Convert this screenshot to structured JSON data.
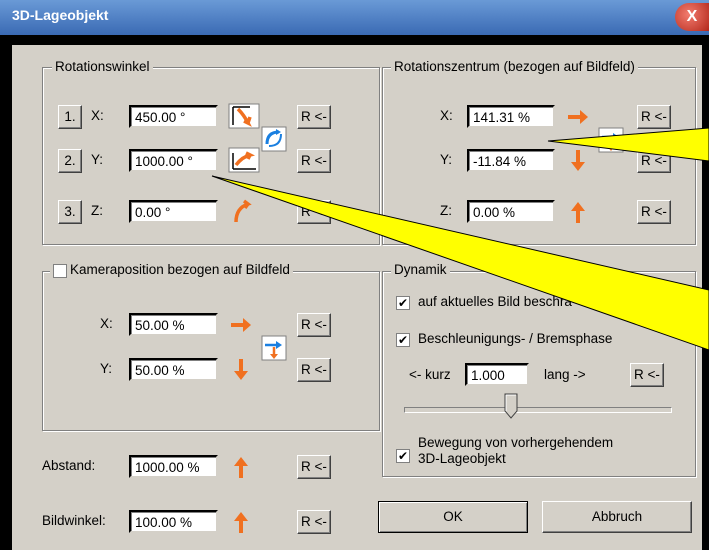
{
  "window": {
    "title": "3D-Lageobjekt",
    "close_glyph": "X"
  },
  "rotation": {
    "group_title": "Rotationswinkel",
    "rows": [
      {
        "num": "1.",
        "axis": "X:",
        "value": "450.00 °",
        "reset": "R <-"
      },
      {
        "num": "2.",
        "axis": "Y:",
        "value": "1000.00 °",
        "reset": "R <-"
      },
      {
        "num": "3.",
        "axis": "Z:",
        "value": "0.00 °",
        "reset": "R <-"
      }
    ]
  },
  "center": {
    "group_title": "Rotationszentrum (bezogen auf Bildfeld)",
    "rows": [
      {
        "axis": "X:",
        "value": "141.31 %",
        "reset": "R <-"
      },
      {
        "axis": "Y:",
        "value": "-11.84 %",
        "reset": "R <-"
      },
      {
        "axis": "Z:",
        "value": "0.00 %",
        "reset": "R <-"
      }
    ]
  },
  "camera": {
    "checkbox_label": "Kameraposition bezogen auf Bildfeld",
    "rows": [
      {
        "axis": "X:",
        "value": "50.00 %",
        "reset": "R <-"
      },
      {
        "axis": "Y:",
        "value": "50.00 %",
        "reset": "R <-"
      }
    ]
  },
  "dynamics": {
    "group_title": "Dynamik",
    "check1": "auf aktuelles Bild beschrä",
    "check2": "Beschleunigungs- / Bremsphase",
    "short_label": "<- kurz",
    "value": "1.000",
    "long_label": "lang ->",
    "reset": "R <-",
    "check3_line1": "Bewegung von vorhergehendem",
    "check3_line2": "3D-Lageobjekt",
    "check_mark": "✔"
  },
  "abstand": {
    "label": "Abstand:",
    "value": "1000.00 %",
    "reset": "R <-"
  },
  "bildwinkel": {
    "label": "Bildwinkel:",
    "value": "100.00 %",
    "reset": "R <-"
  },
  "buttons": {
    "ok": "OK",
    "cancel": "Abbruch"
  }
}
